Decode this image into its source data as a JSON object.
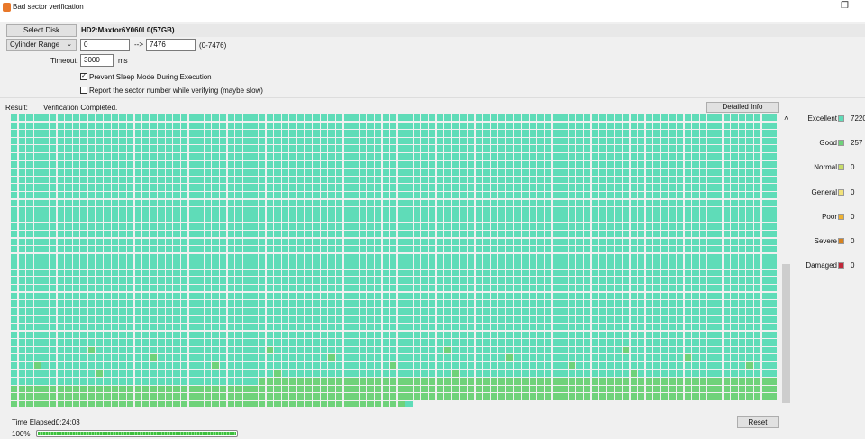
{
  "window": {
    "title": "Bad sector verification"
  },
  "controls": {
    "select_disk": "Select Disk",
    "disk_name": "HD2:Maxtor6Y060L0(57GB)",
    "range_mode": "Cylinder Range",
    "range_from": "0",
    "arrow": "-->",
    "range_to": "7476",
    "range_hint": "(0-7476)",
    "timeout_label": "Timeout:",
    "timeout_value": "3000",
    "timeout_unit": "ms",
    "prevent_sleep": "Prevent Sleep Mode During Execution",
    "prevent_sleep_checked": true,
    "report_sector": "Report the sector number while verifying (maybe slow)",
    "report_sector_checked": false
  },
  "result": {
    "label": "Result:",
    "value": "Verification Completed.",
    "detailed_info": "Detailed Info"
  },
  "legend": [
    {
      "name": "Excellent",
      "color": "#5fdcb8",
      "count": "7220"
    },
    {
      "name": "Good",
      "color": "#6fd27a",
      "count": "257"
    },
    {
      "name": "Normal",
      "color": "#c8dc6a",
      "count": "0"
    },
    {
      "name": "General",
      "color": "#f2e27a",
      "count": "0"
    },
    {
      "name": "Poor",
      "color": "#efb232",
      "count": "0"
    },
    {
      "name": "Severe",
      "color": "#d7821e",
      "count": "0"
    },
    {
      "name": "Damaged",
      "color": "#c0283a",
      "count": "0"
    }
  ],
  "footer": {
    "time_label": "Time Elapsed:",
    "time_value": "0:24:03",
    "percent": "100%",
    "progress": 1.0,
    "reset": "Reset"
  }
}
